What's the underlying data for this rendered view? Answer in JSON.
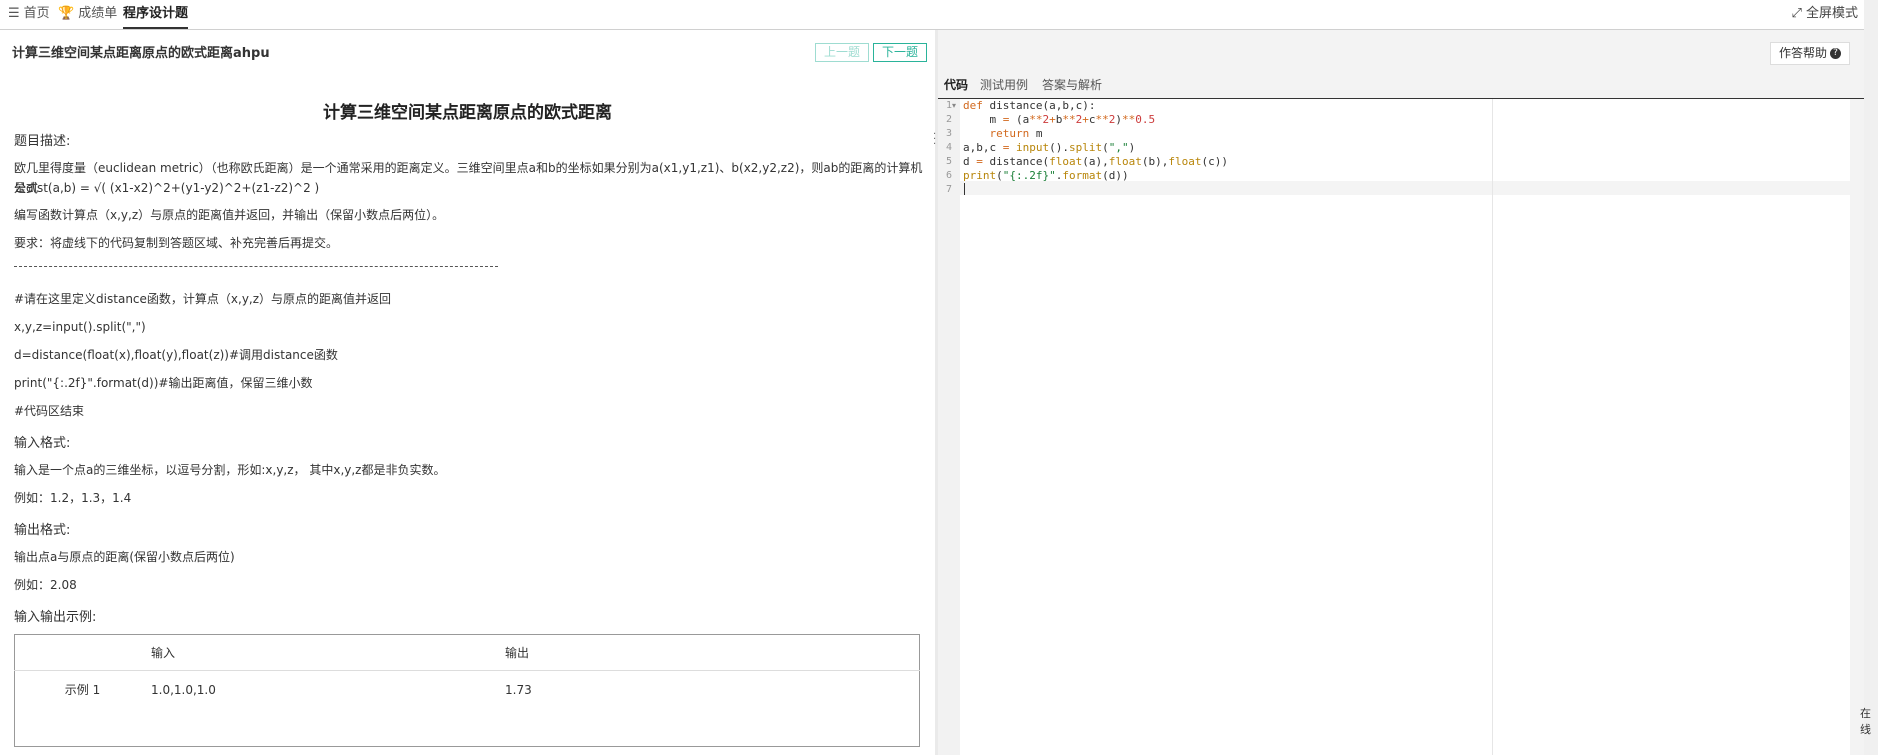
{
  "topbar": {
    "tabs": [
      {
        "label": "首页"
      },
      {
        "label": "成绩单"
      },
      {
        "label": "程序设计题"
      }
    ],
    "fullscreen_label": "全屏模式"
  },
  "left": {
    "problem_title": "计算三维空间某点距离原点的欧式距离ahpu",
    "prev_label": "上一题",
    "next_label": "下一题",
    "content_title": "计算三维空间某点距离原点的欧式距离",
    "desc_heading": "题目描述:",
    "desc_line1": "欧几里得度量（euclidean metric）（也称欧氏距离）是一个通常采用的距离定义。三维空间里点a和b的坐标如果分别为a(x1,y1,z1)、b(x2,y2,z2)，则ab的距离的计算机公式",
    "desc_line2": "是dist(a,b) = √( (x1-x2)^2+(y1-y2)^2+(z1-z2)^2 )",
    "task_line": "编写函数计算点（x,y,z）与原点的距离值并返回，并输出（保留小数点后两位）。",
    "req_line": "要求：将虚线下的代码复制到答题区域、补充完善后再提交。",
    "code_lines": [
      "#请在这里定义distance函数，计算点（x,y,z）与原点的距离值并返回",
      " x,y,z=input().split(\",\")",
      "d=distance(float(x),float(y),float(z))#调用distance函数",
      "print(\"{:.2f}\".format(d))#输出距离值，保留三维小数",
      "#代码区结束"
    ],
    "input_heading": "输入格式:",
    "input_line": "输入是一个点a的三维坐标，以逗号分割，形如:x,y,z， 其中x,y,z都是非负实数。",
    "input_example": "例如：1.2，1.3，1.4",
    "output_heading": "输出格式:",
    "output_line": "输出点a与原点的距离(保留小数点后两位)",
    "output_example": "例如：2.08",
    "io_heading": "输入输出示例:",
    "table": {
      "col_input": "输入",
      "col_output": "输出",
      "rows": [
        {
          "name": "示例 1",
          "input": "1.0,1.0,1.0",
          "output": "1.73"
        }
      ]
    }
  },
  "right": {
    "help_label": "作答帮助",
    "tabs": [
      {
        "label": "代码"
      },
      {
        "label": "测试用例"
      },
      {
        "label": "答案与解析"
      }
    ],
    "line_numbers": [
      "1",
      "2",
      "3",
      "4",
      "5",
      "6",
      "7"
    ]
  },
  "corner_text": "在线"
}
